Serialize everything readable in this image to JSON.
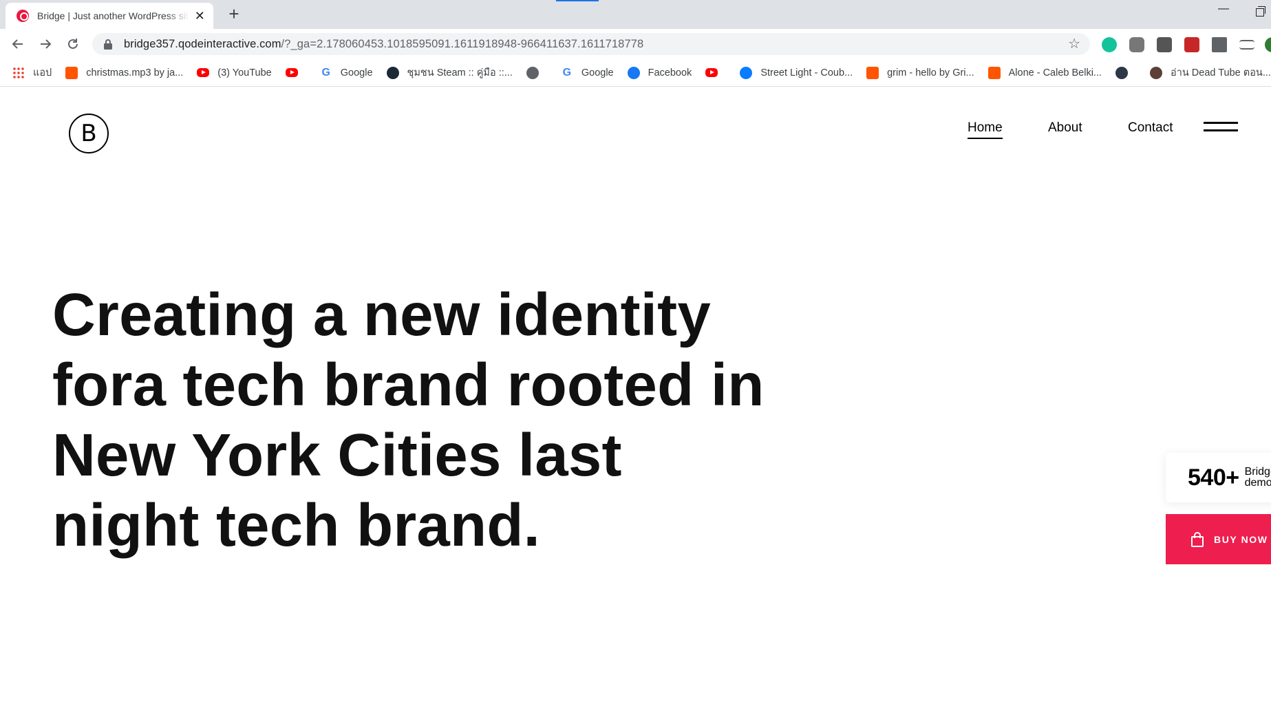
{
  "browser": {
    "tab": {
      "title": "Bridge | Just another WordPress site"
    },
    "url": {
      "host": "bridge357.qodeinteractive.com",
      "path": "/?_ga=2.178060453.1018595091.1611918948-966411637.1611718778"
    },
    "bookmarks": [
      {
        "label": "แอป",
        "icon": "apps-grid-icon"
      },
      {
        "label": "christmas.mp3 by ja...",
        "icon": "soundcloud-icon"
      },
      {
        "label": "(3) YouTube",
        "icon": "youtube-icon"
      },
      {
        "label": "",
        "icon": "youtube-icon"
      },
      {
        "label": "Google",
        "icon": "google-icon"
      },
      {
        "label": "ชุมชน Steam :: คู่มือ ::...",
        "icon": "steam-icon"
      },
      {
        "label": "",
        "icon": "globe-icon"
      },
      {
        "label": "Google",
        "icon": "google-icon"
      },
      {
        "label": "Facebook",
        "icon": "facebook-icon"
      },
      {
        "label": "",
        "icon": "youtube-icon"
      },
      {
        "label": "Street Light - Coub...",
        "icon": "messenger-icon"
      },
      {
        "label": "grim - hello by Gri...",
        "icon": "soundcloud-icon"
      },
      {
        "label": "Alone - Caleb Belki...",
        "icon": "soundcloud-icon"
      },
      {
        "label": "",
        "icon": "dark-circle-icon"
      },
      {
        "label": "อ่าน Dead Tube ตอน...",
        "icon": "paw-icon"
      }
    ]
  },
  "site": {
    "logo": "B",
    "nav": {
      "home": "Home",
      "about": "About",
      "contact": "Contact"
    },
    "hero": "Creating a new identity fora tech brand rooted in New York Cities last night tech brand.",
    "demos": {
      "count": "540+",
      "label": "Bridge demos"
    },
    "buy": {
      "label": "BUY NOW $"
    },
    "colors": {
      "accent": "#ee1e4f",
      "text": "#000000"
    }
  }
}
